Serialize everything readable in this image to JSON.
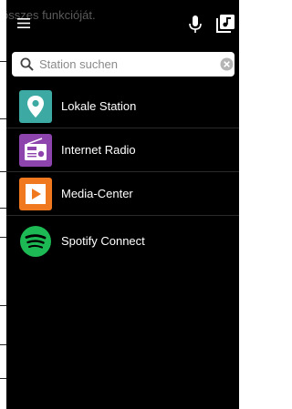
{
  "background": {
    "text": "összes funkcióját."
  },
  "topbar": {
    "menu_icon": "hamburger-menu-icon",
    "mic_icon": "microphone-icon",
    "library_icon": "music-library-icon"
  },
  "search": {
    "placeholder": "Station suchen",
    "value": ""
  },
  "sources": [
    {
      "label": "Lokale Station",
      "icon": "location-pin-icon",
      "color": "#3da9a3"
    },
    {
      "label": "Internet Radio",
      "icon": "radio-icon",
      "color": "#8e44ad"
    },
    {
      "label": "Media-Center",
      "icon": "play-icon",
      "color": "#f0781e"
    },
    {
      "label": "Spotify Connect",
      "icon": "spotify-icon",
      "color": "#1db954"
    }
  ]
}
